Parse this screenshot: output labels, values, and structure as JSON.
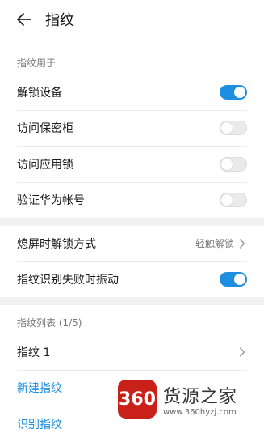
{
  "header": {
    "title": "指纹"
  },
  "section_usage": {
    "label": "指纹用于",
    "items": [
      {
        "label": "解锁设备",
        "state": "on"
      },
      {
        "label": "访问保密柜",
        "state": "off"
      },
      {
        "label": "访问应用锁",
        "state": "off"
      },
      {
        "label": "验证华为帐号",
        "state": "off"
      }
    ]
  },
  "section_screen": {
    "unlock_method": {
      "label": "熄屏时解锁方式",
      "value": "轻触解锁"
    },
    "vibrate": {
      "label": "指纹识别失败时振动",
      "state": "on"
    }
  },
  "section_list": {
    "label": "指纹列表 (1/5)",
    "fingerprint1": "指纹 1",
    "add_label": "新建指纹",
    "identify_label": "识别指纹"
  },
  "watermark": {
    "badge": "360",
    "name": "货源之家",
    "url": "www.360hyzj.com"
  },
  "colors": {
    "accent": "#1e8fe0",
    "link": "#1b8ee0"
  }
}
